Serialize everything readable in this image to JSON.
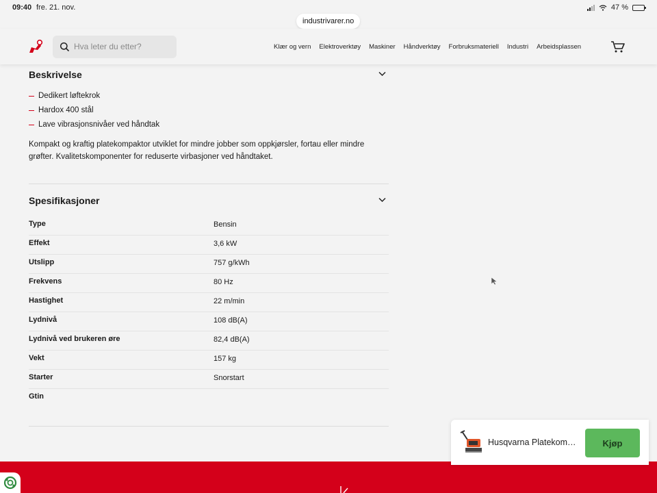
{
  "status_bar": {
    "time": "09:40",
    "date": "fre. 21. nov.",
    "battery": "47 %",
    "battery_level": 0.47
  },
  "browser": {
    "url": "industrivarer.no"
  },
  "header": {
    "search_placeholder": "Hva leter du etter?",
    "nav": [
      "Klær og vern",
      "Elektroverktøy",
      "Maskiner",
      "Håndverktøy",
      "Forbruksmateriell",
      "Industri",
      "Arbeidsplassen"
    ]
  },
  "description": {
    "title": "Beskrivelse",
    "bullets": [
      "Dedikert løftekrok",
      "Hardox 400 stål",
      "Lave vibrasjonsnivåer ved håndtak"
    ],
    "text": "Kompakt og kraftig platekompaktor utviklet for mindre jobber som oppkjørsler, fortau eller mindre grøfter. Kvalitetskomponenter for reduserte virbasjoner ved håndtaket."
  },
  "specs": {
    "title": "Spesifikasjoner",
    "rows": [
      {
        "label": "Type",
        "value": "Bensin"
      },
      {
        "label": "Effekt",
        "value": "3,6 kW"
      },
      {
        "label": "Utslipp",
        "value": "757 g/kWh"
      },
      {
        "label": "Frekvens",
        "value": "80 Hz"
      },
      {
        "label": "Hastighet",
        "value": "22 m/min"
      },
      {
        "label": "Lydnivå",
        "value": "108 dB(A)"
      },
      {
        "label": "Lydnivå ved brukeren øre",
        "value": "82,4 dB(A)"
      },
      {
        "label": "Vekt",
        "value": "157 kg"
      },
      {
        "label": "Starter",
        "value": "Snorstart"
      },
      {
        "label": "Gtin",
        "value": ""
      }
    ]
  },
  "buy_bar": {
    "product_name": "Husqvarna Platekompaktor",
    "buy_label": "Kjøp"
  },
  "colors": {
    "brand_red": "#d4001a",
    "buy_green": "#5cb85c"
  }
}
